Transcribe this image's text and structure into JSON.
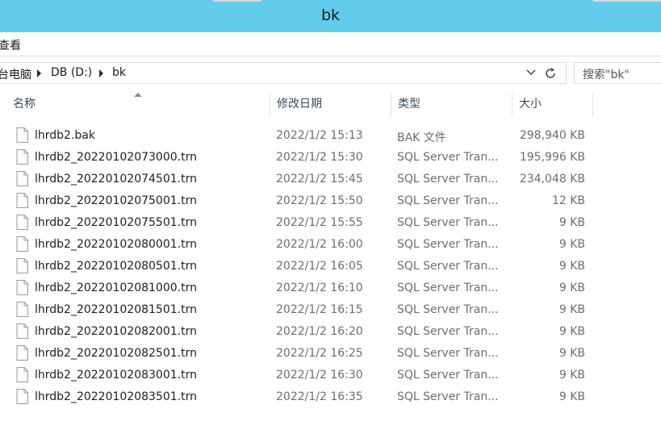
{
  "window": {
    "title": "bk"
  },
  "menu": {
    "view_label": "查看"
  },
  "address": {
    "crumbs": [
      "台电脑",
      "DB (D:)",
      "bk"
    ]
  },
  "search": {
    "placeholder": "搜索\"bk\""
  },
  "columns": {
    "name": "名称",
    "date": "修改日期",
    "type": "类型",
    "size": "大小"
  },
  "files": [
    {
      "name": "lhrdb2.bak",
      "date": "2022/1/2 15:13",
      "type": "BAK 文件",
      "size": "298,940 KB"
    },
    {
      "name": "lhrdb2_20220102073000.trn",
      "date": "2022/1/2 15:30",
      "type": "SQL Server Tran...",
      "size": "195,996 KB"
    },
    {
      "name": "lhrdb2_20220102074501.trn",
      "date": "2022/1/2 15:45",
      "type": "SQL Server Tran...",
      "size": "234,048 KB"
    },
    {
      "name": "lhrdb2_20220102075001.trn",
      "date": "2022/1/2 15:50",
      "type": "SQL Server Tran...",
      "size": "12 KB"
    },
    {
      "name": "lhrdb2_20220102075501.trn",
      "date": "2022/1/2 15:55",
      "type": "SQL Server Tran...",
      "size": "9 KB"
    },
    {
      "name": "lhrdb2_20220102080001.trn",
      "date": "2022/1/2 16:00",
      "type": "SQL Server Tran...",
      "size": "9 KB"
    },
    {
      "name": "lhrdb2_20220102080501.trn",
      "date": "2022/1/2 16:05",
      "type": "SQL Server Tran...",
      "size": "9 KB"
    },
    {
      "name": "lhrdb2_20220102081000.trn",
      "date": "2022/1/2 16:10",
      "type": "SQL Server Tran...",
      "size": "9 KB"
    },
    {
      "name": "lhrdb2_20220102081501.trn",
      "date": "2022/1/2 16:15",
      "type": "SQL Server Tran...",
      "size": "9 KB"
    },
    {
      "name": "lhrdb2_20220102082001.trn",
      "date": "2022/1/2 16:20",
      "type": "SQL Server Tran...",
      "size": "9 KB"
    },
    {
      "name": "lhrdb2_20220102082501.trn",
      "date": "2022/1/2 16:25",
      "type": "SQL Server Tran...",
      "size": "9 KB"
    },
    {
      "name": "lhrdb2_20220102083001.trn",
      "date": "2022/1/2 16:30",
      "type": "SQL Server Tran...",
      "size": "9 KB"
    },
    {
      "name": "lhrdb2_20220102083501.trn",
      "date": "2022/1/2 16:35",
      "type": "SQL Server Tran...",
      "size": "9 KB"
    }
  ],
  "colors": {
    "titlebar": "#63cbec"
  },
  "icons": {
    "file": "file-icon",
    "dropdown": "chevron-down-icon",
    "refresh": "refresh-icon"
  }
}
